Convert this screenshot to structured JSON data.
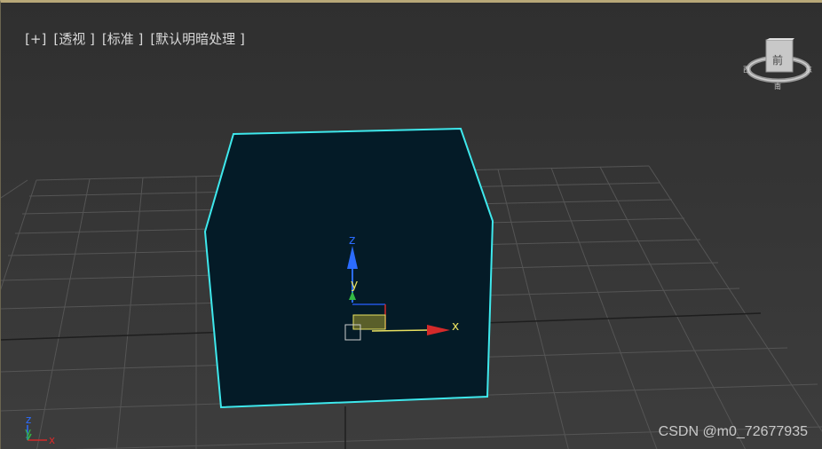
{
  "viewport": {
    "labels": {
      "plus": "[+]",
      "view": "[透视 ]",
      "shading": "[标准 ]",
      "lighting": "[默认明暗处理 ]"
    },
    "colors": {
      "selection_edge": "#3ee8ec",
      "box_face": "#041b27",
      "frame_border": "#b8a878",
      "x_axis": "#d42a2a",
      "y_axis": "#33bb44",
      "z_axis": "#2b6cff",
      "axis_label": "#e8e060"
    }
  },
  "gizmo": {
    "x_label": "x",
    "y_label": "y",
    "z_label": "z"
  },
  "view_cube": {
    "face_label": "前",
    "compass_south": "南",
    "compass_west": "西",
    "compass_east": "东"
  },
  "world_axes": {
    "x_label": "x",
    "y_label": "y",
    "z_label": "z"
  },
  "watermark": "CSDN @m0_72677935"
}
